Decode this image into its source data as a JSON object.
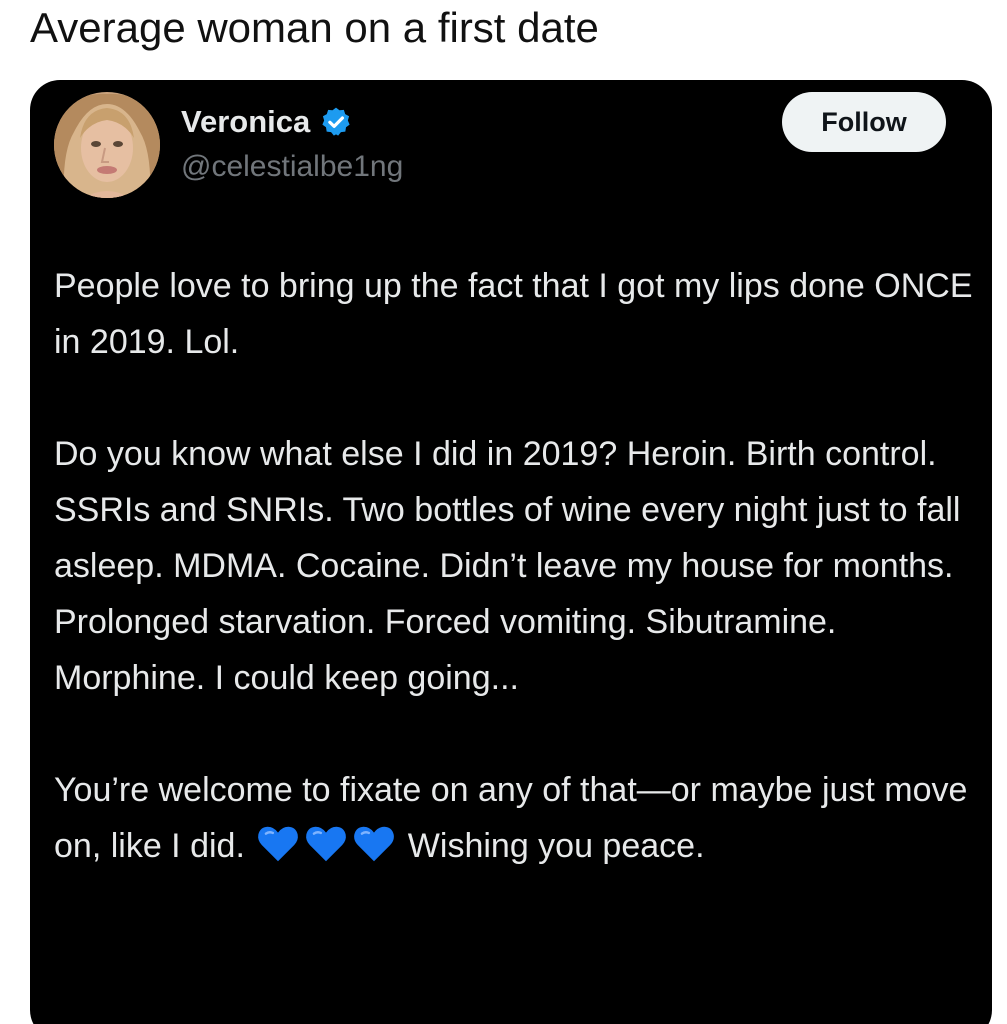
{
  "caption": "Average woman on a first date",
  "tweet": {
    "author_name": "Veronica",
    "author_handle": "@celestialbe1ng",
    "follow_label": "Follow",
    "paragraphs": [
      "People love to bring up the fact that I got my lips done ONCE in 2019. Lol.",
      "Do you know what else I did in 2019? Heroin. Birth control. SSRIs and SNRIs. Two bottles of wine every night just to fall asleep. MDMA. Cocaine. Didn’t leave my house for months. Prolonged starvation. Forced vomiting. Sibutramine. Morphine. I could keep going..."
    ],
    "last_paragraph": {
      "before_emoji": "You’re welcome to fixate on any of that—or maybe just move on, like I did.",
      "emoji": [
        "blue-heart",
        "blue-heart",
        "blue-heart"
      ],
      "after_emoji": "Wishing you peace."
    }
  },
  "icons": {
    "verified": "verified-badge-icon",
    "heart": "blue-heart-icon"
  },
  "colors": {
    "card_background": "#000000",
    "primary_text": "#e7e9ea",
    "secondary_text": "#71767b",
    "verified_blue": "#1d9bf0",
    "heart_blue": "#1877f2",
    "follow_button_bg": "#eff3f4"
  }
}
